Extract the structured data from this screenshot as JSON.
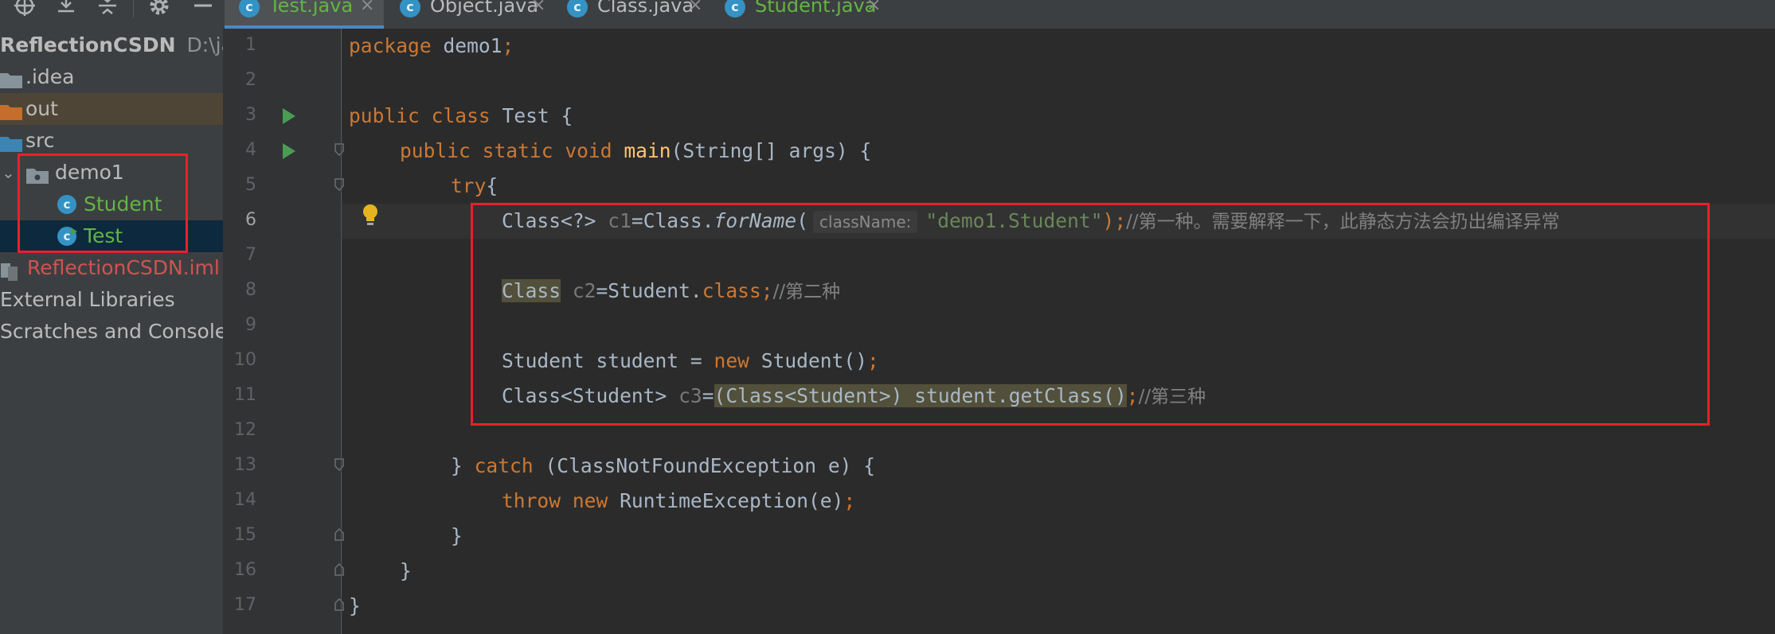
{
  "project": {
    "root_name": "ReflectionCSDN",
    "root_path": "D:\\java",
    "items": {
      "idea": ".idea",
      "out": "out",
      "src": "src",
      "package": "demo1",
      "student": "Student",
      "test": "Test",
      "iml": "ReflectionCSDN.iml",
      "external": "External Libraries",
      "scratches": "Scratches and Consoles"
    }
  },
  "tabs": [
    {
      "label": "Test.java",
      "close": "×"
    },
    {
      "label": "Object.java",
      "close": "×"
    },
    {
      "label": "Class.java",
      "close": "×"
    },
    {
      "label": "Student.java",
      "close": "×"
    }
  ],
  "icons": {
    "tab_glyph": "c",
    "file_glyph": "c",
    "toolbar": [
      "locate-icon",
      "expand-all-icon",
      "collapse-all-icon",
      "gear-icon",
      "hide-icon"
    ]
  },
  "line_numbers": [
    "1",
    "2",
    "3",
    "4",
    "5",
    "6",
    "7",
    "8",
    "9",
    "10",
    "11",
    "12",
    "13",
    "14",
    "15",
    "16",
    "17"
  ],
  "code": {
    "l1": {
      "kw": "package",
      "rest": " demo1",
      "semi": ";"
    },
    "l3": {
      "kw1": "public",
      "kw2": "class",
      "rest": " Test {"
    },
    "l4": {
      "kw1": "public",
      "kw2": "static",
      "kw3": "void",
      "fn": "main",
      "rest": "(String[] args) {"
    },
    "l5": {
      "kw": "try",
      "rest": "{"
    },
    "l6": {
      "p1": "Class<?> ",
      "var": "c1",
      "p2": "=Class.",
      "method": "forName",
      "p3": "(",
      "hint": "className:",
      "str": "\"demo1.Student\"",
      "p4": ");",
      "comment": "//第一种。需要解释一下，此静态方法会扔出编译异常"
    },
    "l8": {
      "hl": "Class",
      "var": " c2",
      "p1": "=Student.",
      "kw": "class;",
      "comment": "//第二种"
    },
    "l10": {
      "p1": "Student student = ",
      "kw": "new",
      "p2": " Student()",
      "semi": ";"
    },
    "l11": {
      "p1": "Class<Student> ",
      "var": "c3",
      "p2": "=",
      "hl": "(Class<Student>) student.getClass()",
      "semi": ";",
      "comment": "//第三种"
    },
    "l13": {
      "p1": "} ",
      "kw": "catch",
      "p2": " (ClassNotFoundException e) {"
    },
    "l14": {
      "kw1": "throw",
      "kw2": " new",
      "p1": " RuntimeException(e)",
      "semi": ";"
    },
    "l15": {
      "text": "}"
    },
    "l16": {
      "text": "}"
    },
    "l17": {
      "text": "}"
    }
  },
  "colors": {
    "accent_red": "#e8212a",
    "keyword": "#cc7832",
    "method": "#ffc66d",
    "string": "#6a8759",
    "comment": "#808080",
    "green_file": "#62b543"
  }
}
